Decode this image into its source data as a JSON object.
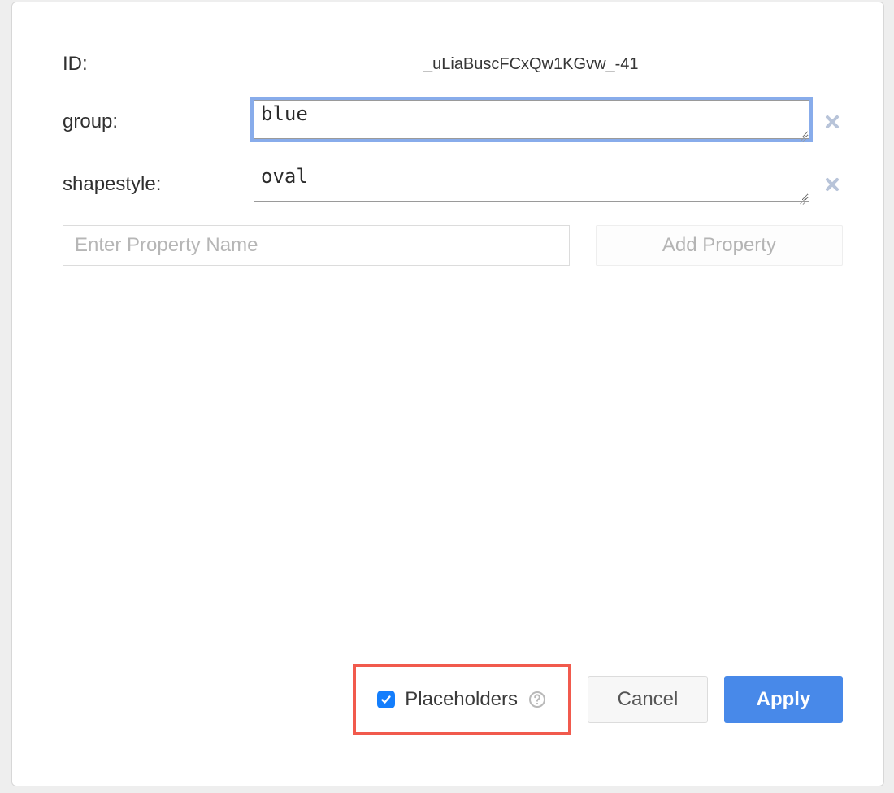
{
  "labels": {
    "id": "ID:",
    "group": "group:",
    "shapestyle": "shapestyle:"
  },
  "values": {
    "id": "_uLiaBuscFCxQw1KGvw_-41",
    "group": "blue",
    "shapestyle": "oval"
  },
  "newprop": {
    "placeholder": "Enter Property Name",
    "add_label": "Add Property"
  },
  "footer": {
    "placeholders_label": "Placeholders",
    "placeholders_checked": true,
    "cancel": "Cancel",
    "apply": "Apply"
  },
  "colors": {
    "focus_ring": "#88aceb",
    "primary_button": "#4889e9",
    "highlight_box": "#f15a4d",
    "checkbox_fill": "#147efc",
    "close_icon": "#b8c4d9"
  }
}
